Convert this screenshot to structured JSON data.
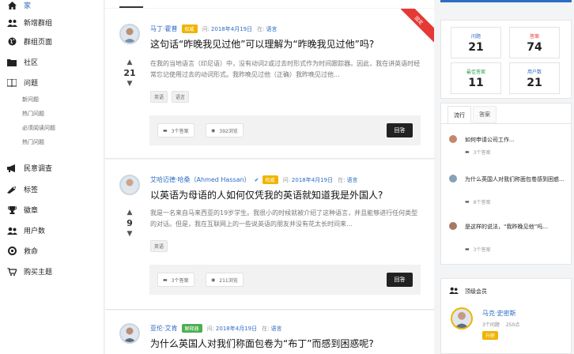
{
  "sidebar": {
    "items": [
      {
        "icon": "home-icon",
        "label": "家"
      },
      {
        "icon": "users-icon",
        "label": "新增群组"
      },
      {
        "icon": "globe-icon",
        "label": "群组页面"
      },
      {
        "icon": "folder-icon",
        "label": "社区"
      },
      {
        "icon": "book-icon",
        "label": "问题"
      }
    ],
    "sub_items": [
      "新问题",
      "热门问题",
      "必须阅读问题",
      "热门问题"
    ],
    "items2": [
      {
        "icon": "megaphone-icon",
        "label": "民意调查"
      },
      {
        "icon": "tag-icon",
        "label": "标签"
      },
      {
        "icon": "trophy-icon",
        "label": "徽章"
      },
      {
        "icon": "user-group-icon",
        "label": "用户数"
      },
      {
        "icon": "lifebuoy-icon",
        "label": "救命"
      },
      {
        "icon": "cart-icon",
        "label": "购买主题"
      }
    ]
  },
  "questions": [
    {
      "author": "马丁·霍普",
      "badge": "权威",
      "badge_color": "#f0b400",
      "asked_label": "问:",
      "date": "2018年4月19日",
      "in_label": "在:",
      "category": "语言",
      "title": "这句话“昨晚我见过他”可以理解为“昨晚我见过他”吗?",
      "excerpt": "在我的当地语言（印尼语）中，没有动词2或过去时形式作为时间跟踪器。因此，我在讲英语时经常忘记使用过去的动词形式。我昨晚见过他（正确）我昨晚见过他...",
      "votes": "21",
      "tags": [
        "英语",
        "语言"
      ],
      "answers": "3个答案",
      "views": "392浏览",
      "answer_btn": "回答",
      "ribbon": "固定"
    },
    {
      "author": "艾哈迈德·哈桑（Ahmed Hassan）",
      "badge": "权威",
      "badge_color": "#f0b400",
      "asked_label": "问:",
      "date": "2018年4月19日",
      "in_label": "在:",
      "category": "语言",
      "title": "以英语为母语的人如何仅凭我的英语就知道我是外国人?",
      "excerpt": "我是一名来自马来西亚的19岁学生。我很小的时候就被介绍了这种语言，并且能够进行任何类型的对话。但是，我在互联网上的一些说英语的朋友并没有花太长时间来...",
      "votes": "9",
      "tags": [
        "英语"
      ],
      "answers": "3个答案",
      "views": "211浏览",
      "answer_btn": "回答"
    },
    {
      "author": "亚伦·艾肯",
      "badge": "解释器",
      "badge_color": "#4caf50",
      "asked_label": "问:",
      "date": "2018年4月19日",
      "in_label": "在:",
      "category": "语言",
      "title": "为什么英国人对我们称面包卷为“布丁”而感到困惑呢?"
    }
  ],
  "stats": [
    {
      "label": "问题",
      "value": "21",
      "color": "#2d6cc5"
    },
    {
      "label": "答案",
      "value": "74",
      "color": "#e53935"
    },
    {
      "label": "最佳答案",
      "value": "11",
      "color": "#2e9d4e"
    },
    {
      "label": "用户数",
      "value": "21",
      "color": "#2d6cc5"
    }
  ],
  "tabs": [
    "流行",
    "答案"
  ],
  "popular": [
    {
      "title": "如何申请公司工作...",
      "answers": "3个答案"
    },
    {
      "title": "为什么英国人对我们称面包卷感到困惑...",
      "answers": "8个答案"
    },
    {
      "title": "是这样的说法，“我昨晚见他”吗...",
      "answers": "3个答案"
    }
  ],
  "members": {
    "title": "顶级会员",
    "name": "马克·史密斯",
    "questions": "3个问题",
    "points": "250点",
    "badge": "升职",
    "badge_color": "#f0b400"
  }
}
